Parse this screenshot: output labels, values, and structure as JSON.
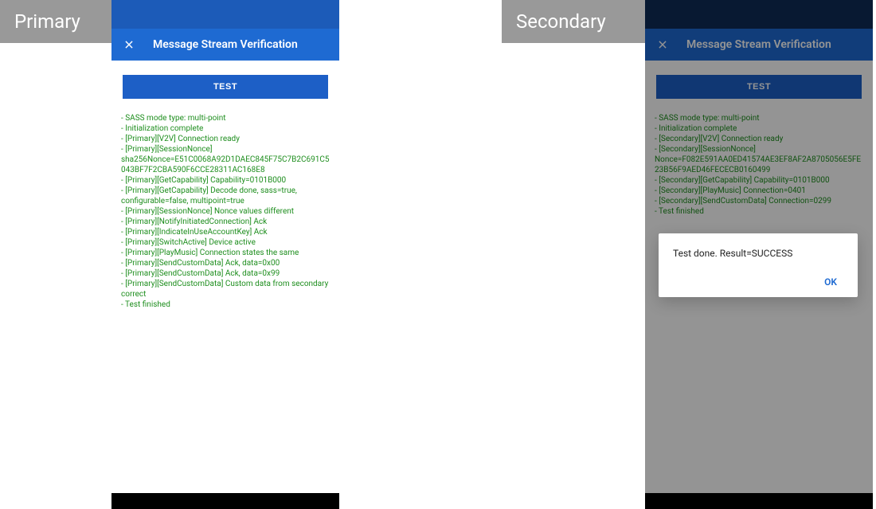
{
  "labels": {
    "primary_badge": "Primary",
    "secondary_badge": "Secondary"
  },
  "primary": {
    "appbar_title": "Message Stream Verification",
    "test_button": "TEST",
    "log": [
      " - SASS mode type: multi-point",
      " - Initialization complete",
      " - [Primary][V2V] Connection ready",
      " - [Primary][SessionNonce] sha256Nonce=E51C0068A92D1DAEC845F75C7B2C691C5043BF7F2CBA590F6CCE28311AC168E8",
      " - [Primary][GetCapability] Capability=0101B000",
      " - [Primary][GetCapability] Decode done, sass=true, configurable=false, multipoint=true",
      " - [Primary][SessionNonce] Nonce values different",
      " - [Primary][NotifyInitiatedConnection] Ack",
      " - [Primary][IndicateInUseAccountKey] Ack",
      " - [Primary][SwitchActive] Device active",
      " - [Primary][PlayMusic] Connection states the same",
      " - [Primary][SendCustomData] Ack, data=0x00",
      " - [Primary][SendCustomData] Ack, data=0x99",
      " - [Primary][SendCustomData] Custom data from secondary correct",
      " - Test finished"
    ]
  },
  "secondary": {
    "appbar_title": "Message Stream Verification",
    "test_button": "TEST",
    "log": [
      " - SASS mode type: multi-point",
      " - Initialization complete",
      " - [Secondary][V2V] Connection ready",
      " - [Secondary][SessionNonce] Nonce=F082E591AA0ED41574AE3EF8AF2A8705056E5FE23B56F9AED46FECECB0160499",
      " - [Secondary][GetCapability] Capability=0101B000",
      " - [Secondary][PlayMusic] Connection=0401",
      " - [Secondary][SendCustomData] Connection=0299",
      " - Test finished"
    ],
    "dialog": {
      "message": "Test done. Result=SUCCESS",
      "ok_label": "OK"
    }
  }
}
